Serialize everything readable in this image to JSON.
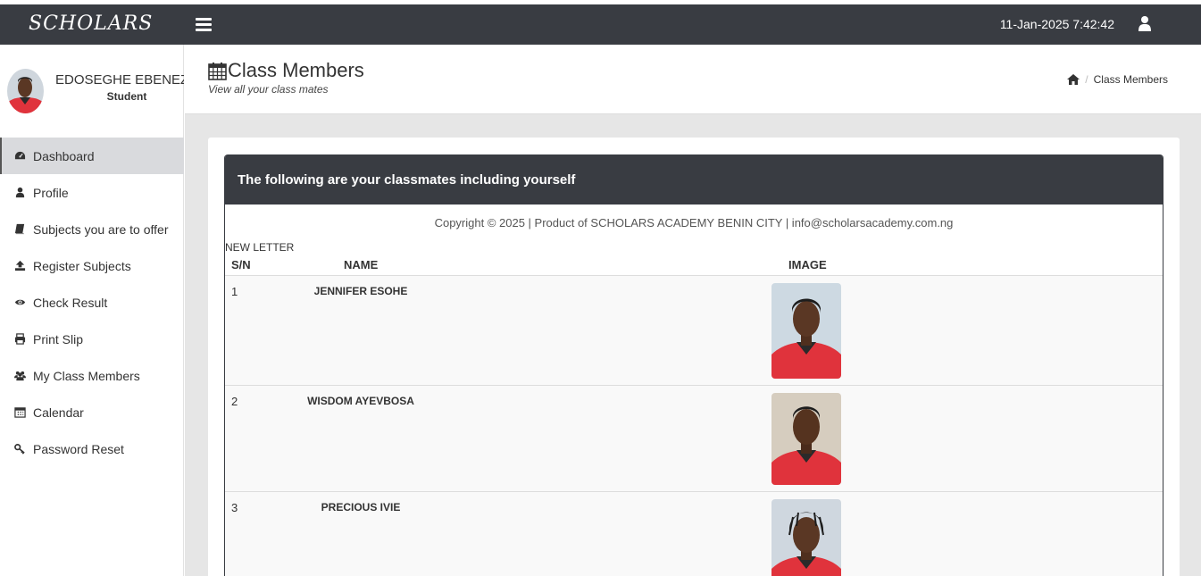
{
  "topbar": {
    "brand": "SCHOLARS",
    "datetime": "11-Jan-2025 7:42:42"
  },
  "profile": {
    "name": "EDOSEGHE EBENEZER",
    "role": "Student"
  },
  "sidebar": {
    "items": [
      {
        "label": "Dashboard",
        "icon": "dashboard-icon"
      },
      {
        "label": "Profile",
        "icon": "user-icon"
      },
      {
        "label": "Subjects you are to offer",
        "icon": "book-icon"
      },
      {
        "label": "Register Subjects",
        "icon": "upload-icon"
      },
      {
        "label": "Check Result",
        "icon": "eye-icon"
      },
      {
        "label": "Print Slip",
        "icon": "print-icon"
      },
      {
        "label": "My Class Members",
        "icon": "users-icon"
      },
      {
        "label": "Calendar",
        "icon": "calendar-icon"
      },
      {
        "label": "Password Reset",
        "icon": "key-icon"
      }
    ]
  },
  "page": {
    "title": "Class Members",
    "subtitle": "View all your class mates",
    "breadcrumb": "Class Members"
  },
  "panel": {
    "heading": "The following are your classmates including yourself",
    "copyright": "Copyright © 2025 | Product of SCHOLARS ACADEMY BENIN CITY | info@scholarsacademy.com.ng",
    "class_name": "NEW LETTER"
  },
  "table": {
    "headers": {
      "sn": "S/N",
      "name": "NAME",
      "image": "IMAGE"
    },
    "rows": [
      {
        "sn": "1",
        "name": "JENNIFER ESOHE"
      },
      {
        "sn": "2",
        "name": "WISDOM AYEVBOSA"
      },
      {
        "sn": "3",
        "name": "PRECIOUS IVIE"
      }
    ]
  },
  "colors": {
    "topbar": "#393c42",
    "active_menu": "#d9dadd",
    "uniform_red": "#e0333c"
  }
}
